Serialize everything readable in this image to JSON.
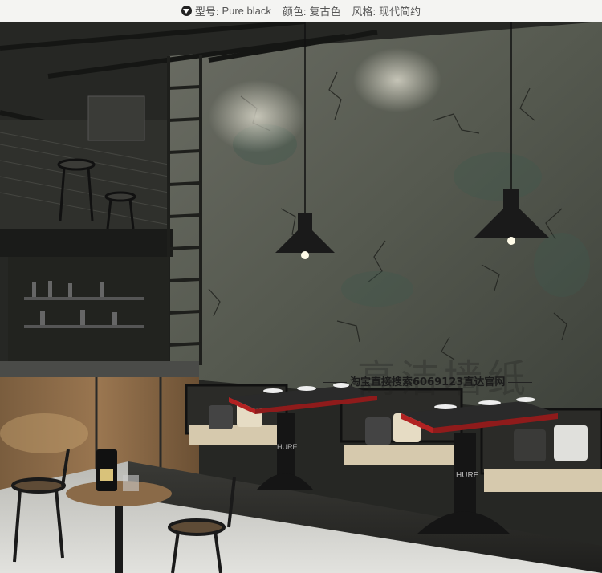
{
  "spec_bar": {
    "model_label": "型号:",
    "model_value": "Pure black",
    "color_label": "颜色:",
    "color_value": "复古色",
    "style_label": "风格:",
    "style_value": "现代简约"
  },
  "watermark": {
    "search_text": "淘宝直接搜索6069123直达官网",
    "brand_text": "高洁墙纸"
  },
  "table_logos": {
    "left": "HURE",
    "right": "HURE"
  },
  "colors": {
    "wall": "#5c5f55",
    "wall_dark": "#3d403a",
    "floor": "#cfcfcb",
    "table_top_accent": "#b22222",
    "lamp": "#1a1a1a"
  }
}
